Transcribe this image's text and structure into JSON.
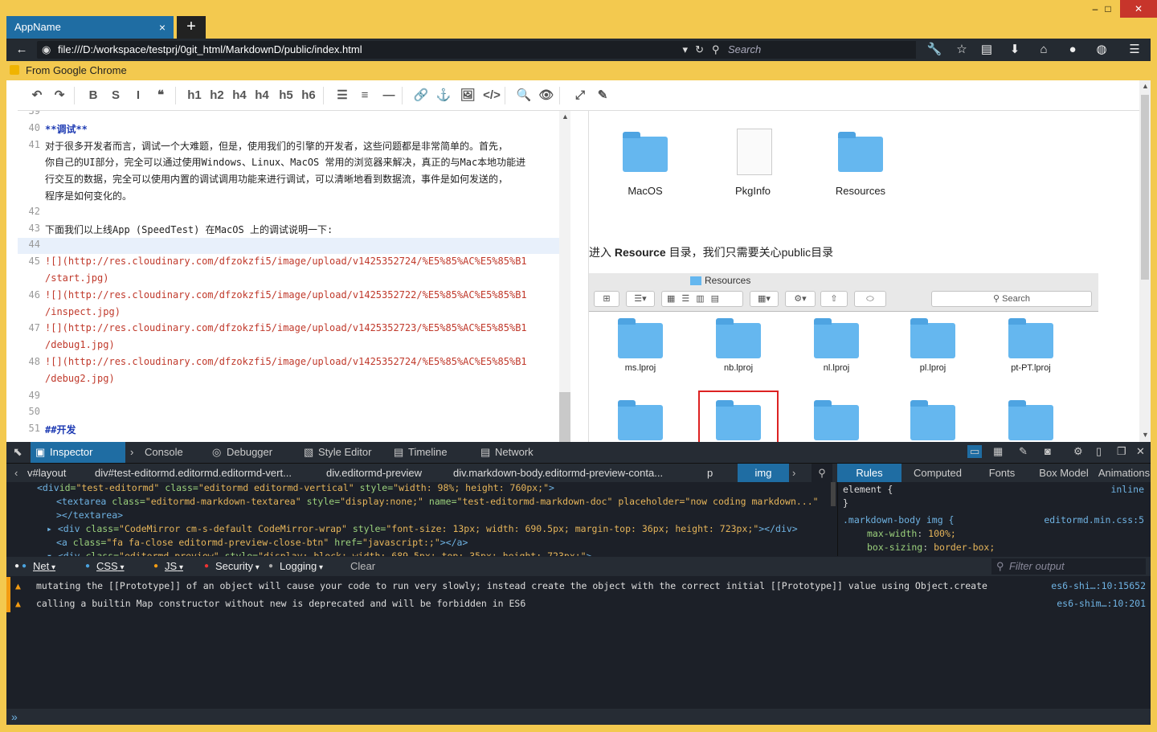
{
  "app": {
    "tab_title": "AppName",
    "new_tab": "+",
    "close": "×"
  },
  "window": {
    "minimize": "–",
    "maximize": "□",
    "close": "✕"
  },
  "nav": {
    "url": "file:///D:/workspace/testprj/0git_html/MarkdownD/public/index.html",
    "search_placeholder": "Search"
  },
  "bookmarks": {
    "folder": "From Google Chrome"
  },
  "toolbar": {
    "buttons": [
      "↶",
      "↷",
      "B",
      "S",
      "I",
      "❝",
      "h1",
      "h2",
      "h4",
      "h4",
      "h5",
      "h6",
      "☰",
      "≡",
      "—",
      "🔗",
      "⚓",
      "🖼",
      "</>",
      "🔍",
      "👁",
      "⤢",
      "✎"
    ]
  },
  "editor": {
    "lines": [
      {
        "n": "39",
        "t": ""
      },
      {
        "n": "40",
        "t": "**调试**"
      },
      {
        "n": "41",
        "t": "对于很多开发者而言，调试一个大难题，但是，使用我们的引擎的开发者，这些问题都是非常简单的。首先，"
      },
      {
        "n": "",
        "t": "你自己的UI部分，完全可以通过使用Windows、Linux、MacOS 常用的浏览器来解决，真正的与Mac本地功能进"
      },
      {
        "n": "",
        "t": "行交互的数据，完全可以使用内置的调试调用功能来进行调试，可以清晰地看到数据流，事件是如何发送的，"
      },
      {
        "n": "",
        "t": "程序是如何变化的。"
      },
      {
        "n": "42",
        "t": ""
      },
      {
        "n": "43",
        "t": "下面我们以上线App (SpeedTest) 在MacOS 上的调试说明一下:"
      },
      {
        "n": "44",
        "t": ""
      },
      {
        "n": "45",
        "t": "![](http://res.cloudinary.com/dfzokzfi5/image/upload/v1425352724/%E5%85%AC%E5%85%B1"
      },
      {
        "n": "",
        "t": "/start.jpg)"
      },
      {
        "n": "46",
        "t": "![](http://res.cloudinary.com/dfzokzfi5/image/upload/v1425352722/%E5%85%AC%E5%85%B1"
      },
      {
        "n": "",
        "t": "/inspect.jpg)"
      },
      {
        "n": "47",
        "t": "![](http://res.cloudinary.com/dfzokzfi5/image/upload/v1425352723/%E5%85%AC%E5%85%B1"
      },
      {
        "n": "",
        "t": "/debug1.jpg)"
      },
      {
        "n": "48",
        "t": "![](http://res.cloudinary.com/dfzokzfi5/image/upload/v1425352724/%E5%85%AC%E5%85%B1"
      },
      {
        "n": "",
        "t": "/debug2.jpg)"
      },
      {
        "n": "49",
        "t": ""
      },
      {
        "n": "50",
        "t": ""
      },
      {
        "n": "51",
        "t": "##开发"
      }
    ]
  },
  "preview": {
    "top_folders": [
      "MacOS",
      "PkgInfo",
      "Resources"
    ],
    "text_pre": "进入 ",
    "text_bold": "Resource",
    "text_post": " 目录，我们只需要关心public目录",
    "finder_title": "Resources",
    "finder_search": "Search",
    "grid_labels": [
      "ms.lproj",
      "nb.lproj",
      "nl.lproj",
      "pl.lproj",
      "pt-PT.lproj"
    ]
  },
  "devtools": {
    "tabs": [
      "Inspector",
      "Console",
      "Debugger",
      "Style Editor",
      "Timeline",
      "Network"
    ],
    "crumbs": [
      "v#layout",
      "div#test-editormd.editormd.editormd-vert...",
      "div.editormd-preview",
      "div.markdown-body.editormd-preview-conta...",
      "p",
      "img"
    ],
    "side_tabs": [
      "Rules",
      "Computed",
      "Fonts",
      "Box Model",
      "Animations"
    ],
    "markup": [
      {
        "tag": "<div",
        "a1": "id=",
        "v1": "\"test-editormd\"",
        "a2": " class=",
        "v2": "\"editormd editormd-vertical\"",
        "a3": " style=",
        "v3": "\"width: 98%; height: 760px;\"",
        "end": ">"
      },
      {
        "tag": "<textarea",
        "a1": " class=",
        "v1": "\"editormd-markdown-textarea\"",
        "a2": " style=",
        "v2": "\"display:none;\"",
        "a3": " name=",
        "v3": "\"test-editormd-markdown-doc\" placeholder=\"now coding markdown...\"",
        "end": ""
      },
      {
        "tag": "></textarea>",
        "a1": "",
        "v1": "",
        "a2": "",
        "v2": "",
        "a3": "",
        "v3": "",
        "end": ""
      },
      {
        "tag": "▸ <div",
        "a1": " class=",
        "v1": "\"CodeMirror cm-s-default CodeMirror-wrap\"",
        "a2": " style=",
        "v2": "\"font-size: 13px; width: 690.5px; margin-top: 36px; height: 723px;\"",
        "a3": "",
        "v3": "",
        "end": "></div>"
      },
      {
        "tag": "<a",
        "a1": " class=",
        "v1": "\"fa fa-close editormd-preview-close-btn\"",
        "a2": " href=",
        "v2": "\"javascript:;\"",
        "a3": "",
        "v3": "",
        "end": "></a>"
      },
      {
        "tag": "▾ <div",
        "a1": " class=",
        "v1": "\"editormd-preview\"",
        "a2": " style=",
        "v2": "\"display: block; width: 689.5px; top: 35px; height: 723px;\"",
        "a3": "",
        "v3": "",
        "end": ">"
      }
    ],
    "rules": {
      "r1_sel": "element {",
      "r1_src": "inline",
      "r1_end": "}",
      "r2_sel": ".markdown-body img {",
      "r2_src": "editormd.min.css:5",
      "p1": "max-width",
      "v1": "100%;",
      "p2": "box-sizing",
      "v2": "border-box;"
    },
    "console_filters": [
      "Net",
      "CSS",
      "JS",
      "Security",
      "Logging",
      "Clear"
    ],
    "filter_placeholder": "Filter output",
    "logs": [
      {
        "msg": "mutating the [[Prototype]] of an object will cause your code to run very slowly; instead create the object with the correct initial [[Prototype]] value using Object.create",
        "src": "es6-shi…:10:15652"
      },
      {
        "msg": "calling a builtin Map constructor without new is deprecated and will be forbidden in ES6",
        "src": "es6-shim…:10:201"
      }
    ],
    "prompt": "»"
  },
  "colors": {
    "accent": "#1f6da3",
    "frame": "#f3c94f",
    "devtools_bg": "#1c2028"
  }
}
